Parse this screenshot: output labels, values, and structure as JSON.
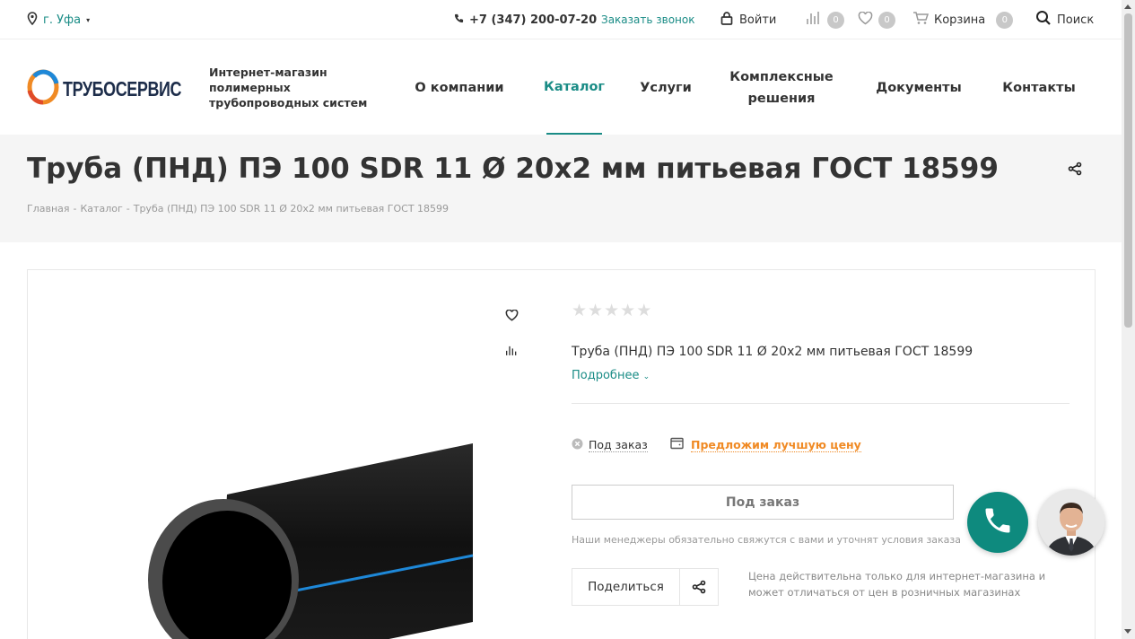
{
  "topbar": {
    "city": "г. Уфа",
    "phone": "+7 (347) 200-07-20",
    "callback": "Заказать звонок",
    "login": "Войти",
    "compare_count": "0",
    "favorites_count": "0",
    "cart_label": "Корзина",
    "cart_count": "0",
    "search_label": "Поиск"
  },
  "header": {
    "logo_text": "ТРУБОСЕРВИС",
    "tagline": "Интернет-магазин полимерных трубопроводных систем",
    "nav": [
      {
        "label": "О компании"
      },
      {
        "label": "Каталог",
        "active": true
      },
      {
        "label": "Услуги"
      },
      {
        "label": "Комплексные решения"
      },
      {
        "label": "Документы"
      },
      {
        "label": "Контакты"
      }
    ]
  },
  "page": {
    "title": "Труба (ПНД) ПЭ 100 SDR 11 Ø 20х2 мм питьевая ГОСТ 18599",
    "breadcrumb": [
      "Главная",
      "Каталог",
      "Труба (ПНД) ПЭ 100 SDR 11 Ø 20х2 мм питьевая ГОСТ 18599"
    ],
    "breadcrumb_sep": "-"
  },
  "product": {
    "rating": 0,
    "rating_max": 5,
    "name": "Труба (ПНД) ПЭ 100 SDR 11 Ø 20х2 мм питьевая ГОСТ 18599",
    "more_link": "Подробнее",
    "availability": "Под заказ",
    "offer_link": "Предложим лучшую цену",
    "order_button": "Под заказ",
    "manager_note": "Наши менеджеры обязательно свяжутся с вами и уточнят условия заказа",
    "share_label": "Поделиться",
    "price_note": "Цена действительна только для интернет-магазина и может отличаться от цен в розничных магазинах"
  },
  "colors": {
    "accent": "#1a8c86",
    "offer": "#f08a24",
    "call_button": "#0e8a7e",
    "pipe_stripe": "#1e88d8"
  },
  "icons": [
    "location-pin-icon",
    "phone-icon",
    "lock-icon",
    "compare-icon",
    "heart-icon",
    "cart-icon",
    "search-icon",
    "share-icon",
    "close-circle-icon",
    "document-icon",
    "chevron-down-icon",
    "phone-call-icon"
  ]
}
